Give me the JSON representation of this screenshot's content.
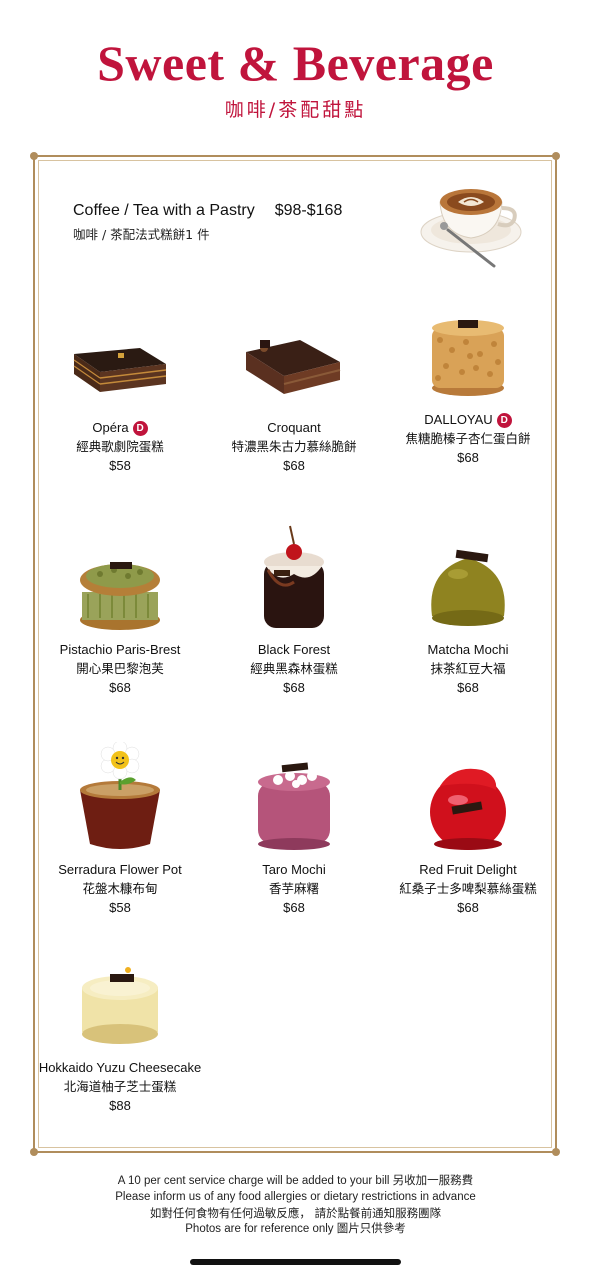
{
  "header": {
    "title": "Sweet & Beverage",
    "subtitle": "咖啡/茶配甜點"
  },
  "combo": {
    "name": "Coffee / Tea with a Pastry",
    "price": "$98-$168",
    "name_cn": "咖啡 / 茶配法式糕餅1 件",
    "image_icon": "latte-cup-icon"
  },
  "items": [
    {
      "name": "Opéra",
      "badge": "D",
      "name_cn": "經典歌劇院蛋糕",
      "price": "$58"
    },
    {
      "name": "Croquant",
      "badge": "",
      "name_cn": "特濃黑朱古力慕絲脆餅",
      "price": "$68"
    },
    {
      "name": "DALLOYAU",
      "badge": "D",
      "name_cn": "焦糖脆榛子杏仁蛋白餅",
      "price": "$68"
    },
    {
      "name": "Pistachio Paris-Brest",
      "badge": "",
      "name_cn": "開心果巴黎泡芙",
      "price": "$68"
    },
    {
      "name": "Black Forest",
      "badge": "",
      "name_cn": "經典黑森林蛋糕",
      "price": "$68"
    },
    {
      "name": "Matcha Mochi",
      "badge": "",
      "name_cn": "抹茶紅豆大福",
      "price": "$68"
    },
    {
      "name": "Serradura Flower Pot",
      "badge": "",
      "name_cn": "花盤木糠布甸",
      "price": "$58"
    },
    {
      "name": "Taro Mochi",
      "badge": "",
      "name_cn": "香芋麻糬",
      "price": "$68"
    },
    {
      "name": "Red Fruit Delight",
      "badge": "",
      "name_cn": "紅桑子士多啤梨慕絲蛋糕",
      "price": "$68"
    },
    {
      "name": "Hokkaido Yuzu Cheesecake",
      "badge": "",
      "name_cn": "北海道柚子芝士蛋糕",
      "price": "$88"
    }
  ],
  "footer": {
    "line1": "A 10 per cent service charge will be added to your bill  另收加一服務費",
    "line2": "Please inform us of any food allergies or dietary restrictions in advance",
    "line3": "如對任何食物有任何過敏反應， 請於點餐前通知服務團隊",
    "line4": "Photos are for reference only  圖片只供參考"
  },
  "colors": {
    "accent": "#c0143c",
    "frame": "#b08d5c"
  }
}
